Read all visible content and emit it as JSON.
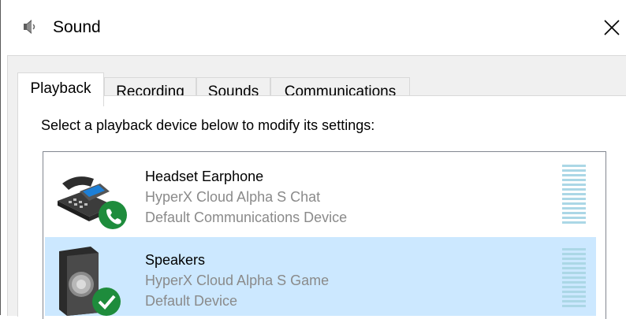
{
  "window": {
    "title": "Sound",
    "close_glyph": "✕",
    "icon": "speaker-icon"
  },
  "tabs": [
    {
      "label": "Playback",
      "active": true
    },
    {
      "label": "Recording",
      "active": false
    },
    {
      "label": "Sounds",
      "active": false
    },
    {
      "label": "Communications",
      "active": false
    }
  ],
  "instruction": "Select a playback device below to modify its settings:",
  "devices": [
    {
      "name": "Headset Earphone",
      "model": "HyperX Cloud Alpha S Chat",
      "status": "Default Communications Device",
      "icon": "headset-phone-icon",
      "badge": "green-phone-badge",
      "selected": false
    },
    {
      "name": "Speakers",
      "model": "HyperX Cloud Alpha S Game",
      "status": "Default Device",
      "icon": "speaker-icon",
      "badge": "green-check-badge",
      "selected": true
    }
  ],
  "colors": {
    "selection": "#cce8ff",
    "meter": "#abd7e6",
    "badge_green": "#1e8c3c"
  }
}
